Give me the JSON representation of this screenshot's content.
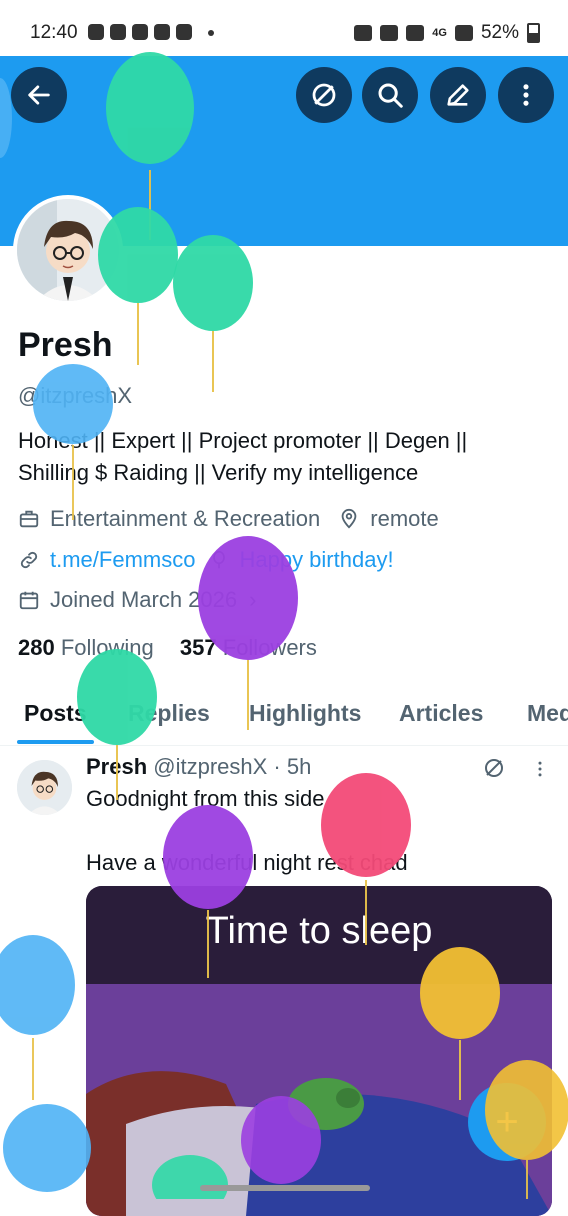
{
  "status_bar": {
    "time": "12:40",
    "battery": "52%",
    "network": "4G"
  },
  "profile": {
    "name": "Presh",
    "handle": "@itzpreshX",
    "bio_line1": "Honest || Expert || Project promoter || Degen ||",
    "bio_line2": "Shilling $ Raiding || Verify my intelligence",
    "category": "Entertainment & Recreation",
    "location": "remote",
    "link": "t.me/Femmsco",
    "birthday": "Happy birthday!",
    "joined": "Joined March 2026",
    "following_count": "280",
    "following_label": "Following",
    "followers_count": "357",
    "followers_label": "Followers"
  },
  "tabs": [
    "Posts",
    "Replies",
    "Highlights",
    "Articles",
    "Med"
  ],
  "post": {
    "name": "Presh",
    "handle_time": "@itzpreshX · 5h",
    "text1": "Goodnight from this side",
    "text2": "Have a wonderful night rest chad",
    "media_title": "Time to sleep"
  },
  "fab_label": "+",
  "colors": {
    "accent": "#1d9bf0",
    "dark_button": "#0f3a5f"
  },
  "icons": [
    "back-icon",
    "grok-icon",
    "search-icon",
    "edit-icon",
    "more-icon",
    "briefcase-icon",
    "location-icon",
    "link-icon",
    "balloon-icon",
    "calendar-icon"
  ]
}
